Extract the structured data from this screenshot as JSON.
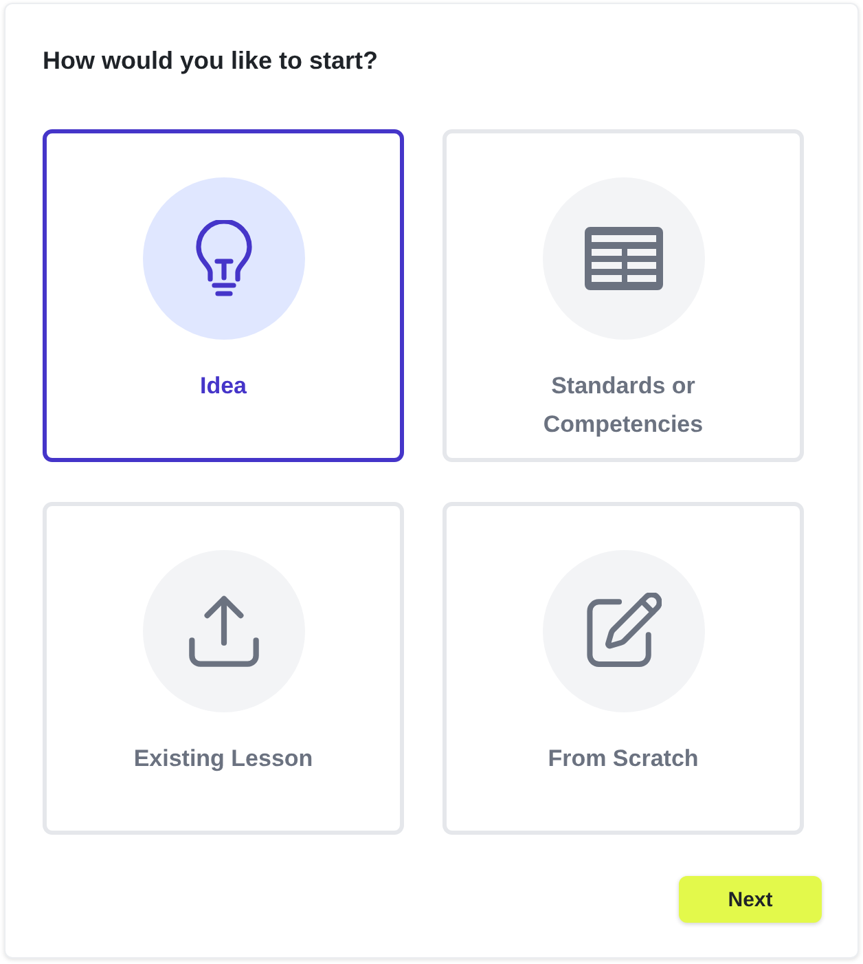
{
  "title": "How would you like to start?",
  "options": [
    {
      "label": "Idea",
      "selected": true
    },
    {
      "label": "Standards or Competencies",
      "selected": false
    },
    {
      "label": "Existing Lesson",
      "selected": false
    },
    {
      "label": "From Scratch",
      "selected": false
    }
  ],
  "next_button": {
    "label": "Next"
  }
}
